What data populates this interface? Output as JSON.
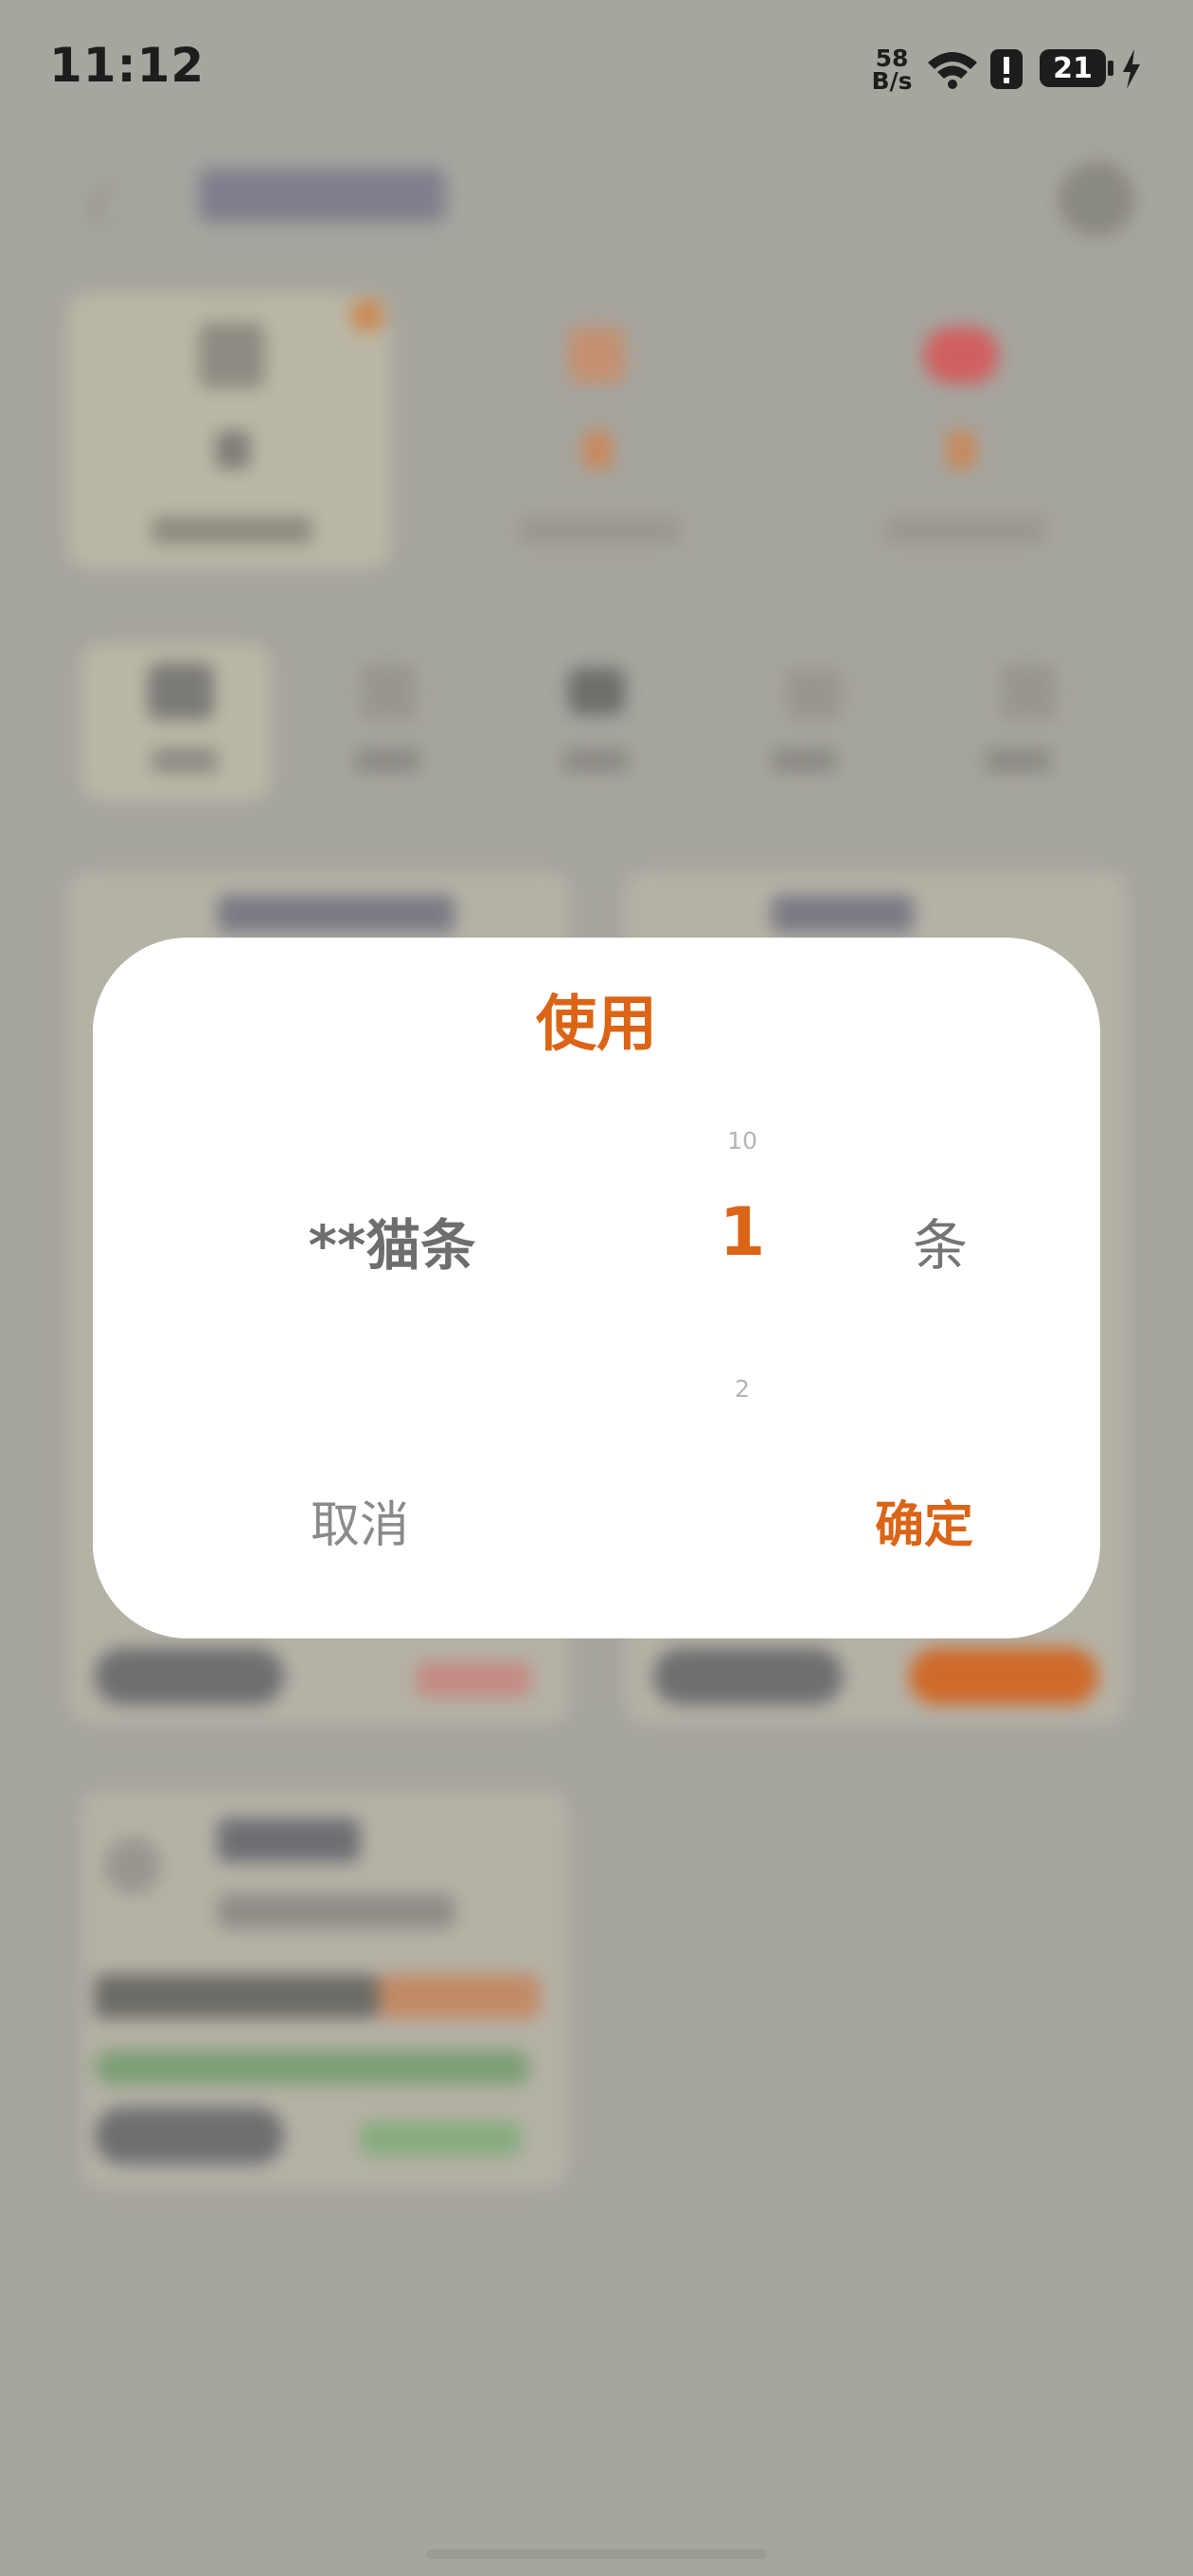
{
  "status_bar": {
    "time": "11:12",
    "net_speed_value": "58",
    "net_speed_unit": "B/s",
    "battery_level": "21",
    "icons": [
      "wifi-icon",
      "alert-icon",
      "battery-icon",
      "charging-icon"
    ]
  },
  "dialog": {
    "title": "使用",
    "item_name": "**猫条",
    "picker": {
      "previous": "10",
      "selected": "1",
      "next": "2"
    },
    "unit": "条",
    "cancel_label": "取消",
    "confirm_label": "确定"
  },
  "colors": {
    "accent": "#db6416",
    "overlay": "#a6a59e",
    "dialog_bg": "#ffffff",
    "muted_text": "#8a8a8a"
  }
}
